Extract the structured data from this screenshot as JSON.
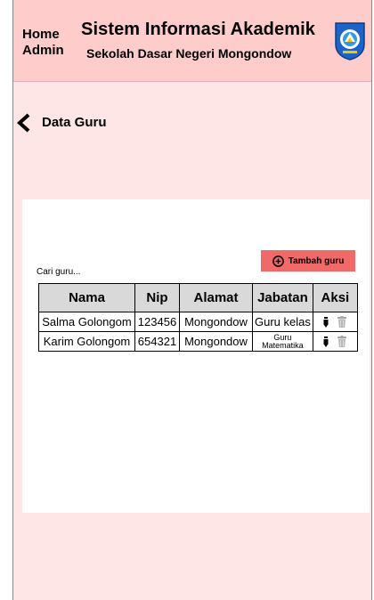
{
  "header": {
    "nav_line1": "Home",
    "nav_line2": "Admin",
    "title": "Sistem Informasi Akademik",
    "school": "Sekolah Dasar Negeri Mongondow",
    "logo_icon": "tut-wuri-handayani-logo"
  },
  "page": {
    "back_icon": "chevron-left-icon",
    "title": "Data Guru"
  },
  "search": {
    "placeholder": "Cari guru..."
  },
  "add_button": {
    "icon": "plus-circle-icon",
    "label": "Tambah guru"
  },
  "table": {
    "headers": {
      "nama": "Nama",
      "nip": "Nip",
      "alamat": "Alamat",
      "jabatan": "Jabatan",
      "aksi": "Aksi"
    },
    "rows": [
      {
        "nama": "Salma Golongom",
        "nip": "123456",
        "alamat": "Mongondow",
        "jabatan": "Guru kelas"
      },
      {
        "nama": "Karim Golongom",
        "nip": "654321",
        "alamat": "Mongondow",
        "jabatan": "Guru Matematika"
      }
    ],
    "action_icons": [
      "edit-pen-icon",
      "delete-trash-icon"
    ]
  },
  "colors": {
    "background": "#fee6e6",
    "header": "#ffcccc",
    "add_button": "#f06a6a",
    "table_header": "#d9d9d9"
  }
}
